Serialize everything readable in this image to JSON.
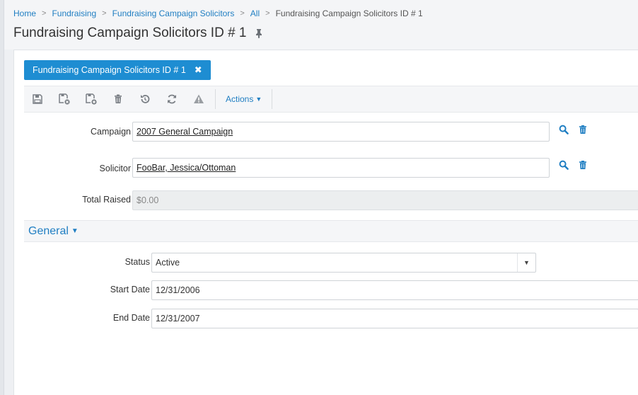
{
  "breadcrumb": {
    "items": [
      "Home",
      "Fundraising",
      "Fundraising Campaign Solicitors",
      "All"
    ],
    "current": "Fundraising Campaign Solicitors ID # 1"
  },
  "page": {
    "title": "Fundraising Campaign Solicitors ID # 1"
  },
  "record_tab": {
    "label": "Fundraising Campaign Solicitors ID # 1",
    "close_glyph": "✖"
  },
  "toolbar": {
    "icons": [
      "save-icon",
      "save-close-icon",
      "save-new-icon",
      "delete-icon",
      "undo-icon",
      "refresh-icon",
      "warning-icon"
    ],
    "actions_label": "Actions",
    "actions_caret": "▼"
  },
  "fields": {
    "campaign": {
      "label": "Campaign",
      "value": "2007 General Campaign"
    },
    "solicitor": {
      "label": "Solicitor",
      "value": "FooBar, Jessica/Ottoman"
    },
    "total_raised": {
      "label": "Total Raised",
      "value": "$0.00"
    }
  },
  "section": {
    "title": "General",
    "caret": "▼"
  },
  "general": {
    "status": {
      "label": "Status",
      "value": "Active"
    },
    "start_date": {
      "label": "Start Date",
      "value": "12/31/2006"
    },
    "end_date": {
      "label": "End Date",
      "value": "12/31/2007"
    }
  },
  "colors": {
    "accent": "#1e8dd2",
    "link": "#1f7ec2",
    "icon_gray": "#7a7f85"
  }
}
